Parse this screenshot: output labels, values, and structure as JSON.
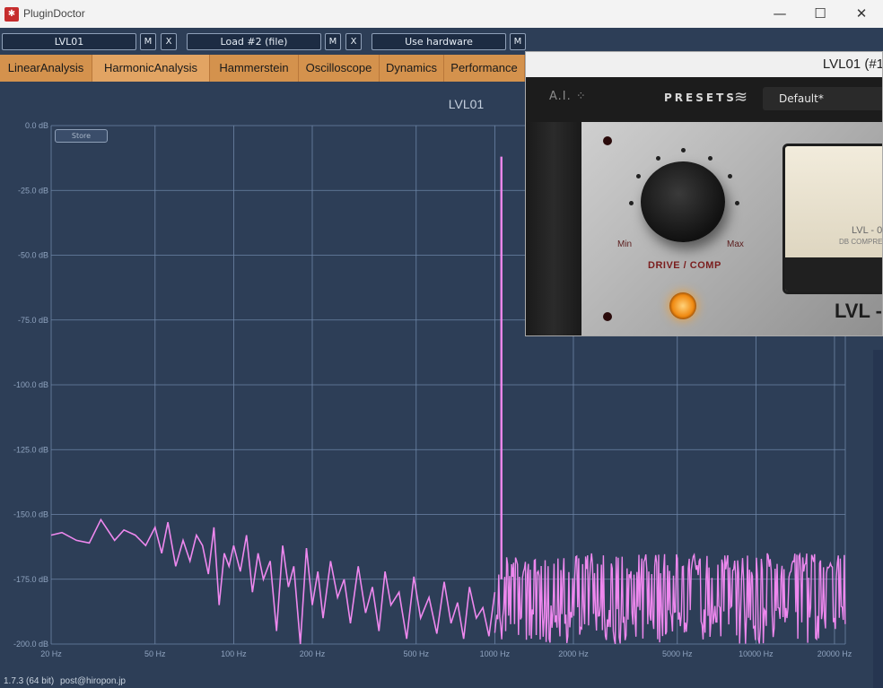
{
  "window": {
    "title": "PluginDoctor",
    "minimize": "—",
    "maximize": "☐",
    "close": "✕"
  },
  "toolbar": {
    "slot1": "LVL01",
    "slot1_m": "M",
    "slot1_x": "X",
    "slot2": "Load #2 (file)",
    "slot2_m": "M",
    "slot2_x": "X",
    "slot3": "Use hardware",
    "slot3_m": "M"
  },
  "tabs": [
    "LinearAnalysis",
    "HarmonicAnalysis",
    "Hammerstein",
    "Oscilloscope",
    "Dynamics",
    "Performance"
  ],
  "active_tab": "HarmonicAnalysis",
  "store_label": "Store",
  "plugin_window": {
    "title": "LVL01 (#1",
    "ai_label": "A.I.",
    "presets_label": "PRESETS",
    "preset_value": "Default*",
    "knob_min": "Min",
    "knob_max": "Max",
    "control_label": "DRIVE / COMP",
    "vu_brand": "LVL - 0",
    "vu_sub": "DB COMPRE",
    "brand": "LVL -"
  },
  "status": {
    "version": "1.7.3 (64 bit)",
    "email": "post@hiropon.jp"
  },
  "chart_data": {
    "type": "line",
    "title": "LVL01",
    "xlabel": "",
    "ylabel": "",
    "x_scale": "log",
    "xlim": [
      20,
      22000
    ],
    "ylim": [
      -200,
      0
    ],
    "y_ticks": [
      0,
      -25,
      -50,
      -75,
      -100,
      -125,
      -150,
      -175,
      -200
    ],
    "y_tick_labels": [
      "0.0 dB",
      "-25.0 dB",
      "-50.0 dB",
      "-75.0 dB",
      "-100.0 dB",
      "-125.0 dB",
      "-150.0 dB",
      "-175.0 dB",
      "-200.0 dB"
    ],
    "x_ticks": [
      20,
      50,
      100,
      200,
      500,
      1000,
      2000,
      5000,
      10000,
      20000
    ],
    "x_tick_labels": [
      "20 Hz",
      "50 Hz",
      "100 Hz",
      "200 Hz",
      "500 Hz",
      "1000 Hz",
      "2000 Hz",
      "5000 Hz",
      "10000 Hz",
      "20000 Hz"
    ],
    "grid": true,
    "line_color": "#ee88ee",
    "peak": {
      "x": 1060,
      "y": -12
    },
    "series": [
      {
        "x": [
          20,
          22,
          25,
          28,
          31,
          35,
          38,
          42,
          46,
          50,
          53,
          56,
          60,
          64,
          68,
          72,
          76,
          80,
          84,
          88,
          92,
          96,
          100,
          106,
          112,
          118,
          124,
          130,
          138,
          146,
          154,
          162,
          170,
          180,
          190,
          200,
          210,
          220,
          235,
          250,
          265,
          280,
          300,
          320,
          340,
          360,
          380,
          400,
          430,
          460,
          490,
          520,
          560,
          600,
          640,
          680,
          720,
          760,
          800,
          850,
          900,
          950,
          1000
        ],
        "y": [
          -158,
          -157,
          -160,
          -161,
          -152,
          -160,
          -156,
          -158,
          -162,
          -155,
          -165,
          -153,
          -170,
          -160,
          -168,
          -158,
          -162,
          -173,
          -155,
          -185,
          -165,
          -170,
          -162,
          -172,
          -158,
          -180,
          -165,
          -175,
          -168,
          -195,
          -162,
          -178,
          -170,
          -200,
          -163,
          -185,
          -172,
          -190,
          -168,
          -182,
          -175,
          -192,
          -170,
          -188,
          -178,
          -195,
          -172,
          -185,
          -180,
          -198,
          -174,
          -190,
          -182,
          -196,
          -176,
          -192,
          -184,
          -198,
          -178,
          -190,
          -186,
          -197,
          -180
        ]
      }
    ]
  }
}
